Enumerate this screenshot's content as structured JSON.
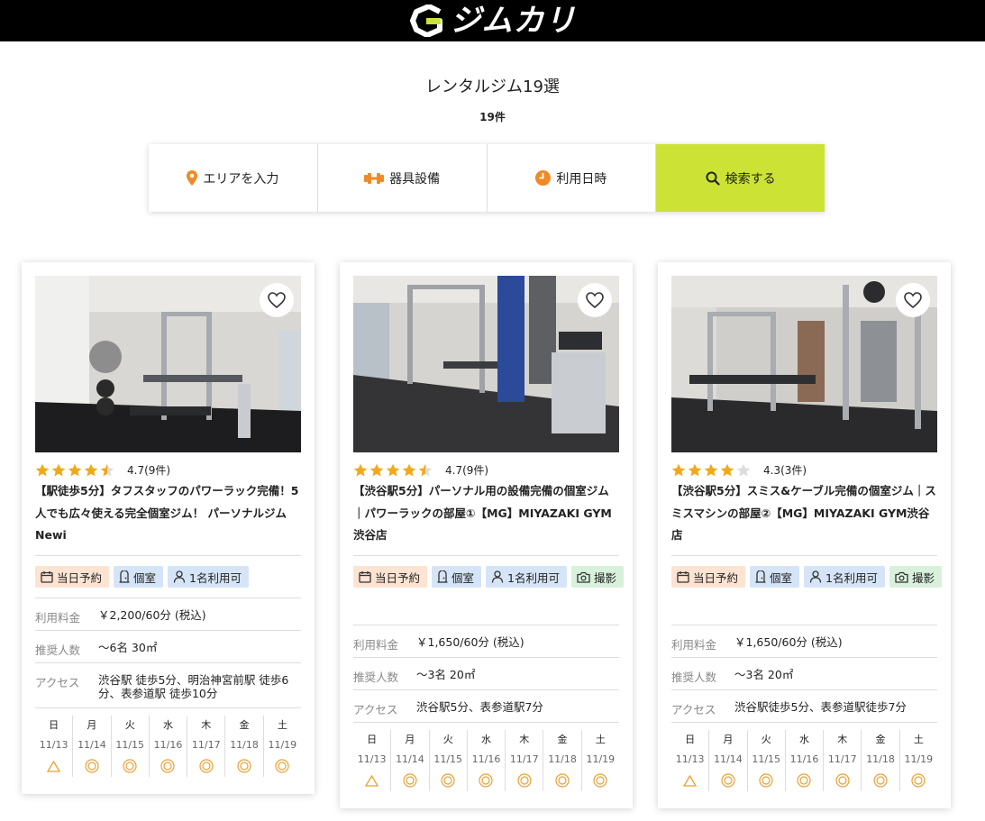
{
  "header": {
    "brand": "ジムカリ",
    "logo_icon": "g-logo-icon",
    "accent": "#cce335"
  },
  "page": {
    "title": "レンタルジム19選",
    "count": "19件"
  },
  "search": [
    {
      "label": "エリアを入力",
      "icon": "pin-icon"
    },
    {
      "label": "器具設備",
      "icon": "dumbbell-icon"
    },
    {
      "label": "利用日時",
      "icon": "clock-icon"
    },
    {
      "label": "検索する",
      "icon": "search-icon"
    }
  ],
  "calendar_days": [
    "日",
    "月",
    "火",
    "水",
    "木",
    "金",
    "土"
  ],
  "calendar_dates": [
    "11/13",
    "11/14",
    "11/15",
    "11/16",
    "11/17",
    "11/18",
    "11/19"
  ],
  "cards": [
    {
      "rating": 4.7,
      "rating_text": "4.7(9件)",
      "stars": 4.5,
      "title": "【駅徒歩5分】タフスタッフのパワーラック完備！5人でも広々使える完全個室ジム！ パーソナルジム　Newi",
      "tags": [
        {
          "label": "当日予約",
          "icon": "calendar-icon",
          "color": "orange"
        },
        {
          "label": "個室",
          "icon": "door-icon",
          "color": "blue"
        },
        {
          "label": "1名利用可",
          "icon": "person-icon",
          "color": "blue"
        }
      ],
      "fee_label": "利用料金",
      "fee": "￥2,200/60分 (税込)",
      "people_label": "推奨人数",
      "people": "〜6名 30㎡",
      "access_label": "アクセス",
      "access": "渋谷駅 徒歩5分、明治神宮前駅 徒歩6分、表参道駅 徒歩10分",
      "availability": [
        "triangle",
        "circle",
        "circle",
        "circle",
        "circle",
        "circle",
        "circle"
      ]
    },
    {
      "rating": 4.7,
      "rating_text": "4.7(9件)",
      "stars": 4.5,
      "title": "【渋谷駅5分】パーソナル用の設備完備の個室ジム｜パワーラックの部屋①【MG】MIYAZAKI GYM渋谷店",
      "tags": [
        {
          "label": "当日予約",
          "icon": "calendar-icon",
          "color": "orange"
        },
        {
          "label": "個室",
          "icon": "door-icon",
          "color": "blue"
        },
        {
          "label": "1名利用可",
          "icon": "person-icon",
          "color": "blue"
        },
        {
          "label": "撮影",
          "icon": "camera-icon",
          "color": "green"
        }
      ],
      "fee_label": "利用料金",
      "fee": "￥1,650/60分 (税込)",
      "people_label": "推奨人数",
      "people": "〜3名 20㎡",
      "access_label": "アクセス",
      "access": "渋谷駅5分、表参道駅7分",
      "availability": [
        "triangle",
        "circle",
        "circle",
        "circle",
        "circle",
        "circle",
        "circle"
      ]
    },
    {
      "rating": 4.3,
      "rating_text": "4.3(3件)",
      "stars": 4,
      "title": "【渋谷駅5分】スミス&ケーブル完備の個室ジム｜スミスマシンの部屋②【MG】MIYAZAKI GYM渋谷店",
      "tags": [
        {
          "label": "当日予約",
          "icon": "calendar-icon",
          "color": "orange"
        },
        {
          "label": "個室",
          "icon": "door-icon",
          "color": "blue"
        },
        {
          "label": "1名利用可",
          "icon": "person-icon",
          "color": "blue"
        },
        {
          "label": "撮影",
          "icon": "camera-icon",
          "color": "green"
        }
      ],
      "fee_label": "利用料金",
      "fee": "￥1,650/60分 (税込)",
      "people_label": "推奨人数",
      "people": "〜3名 20㎡",
      "access_label": "アクセス",
      "access": "渋谷駅徒歩5分、表参道駅徒歩7分",
      "availability": [
        "triangle",
        "circle",
        "circle",
        "circle",
        "circle",
        "circle",
        "circle"
      ]
    }
  ]
}
